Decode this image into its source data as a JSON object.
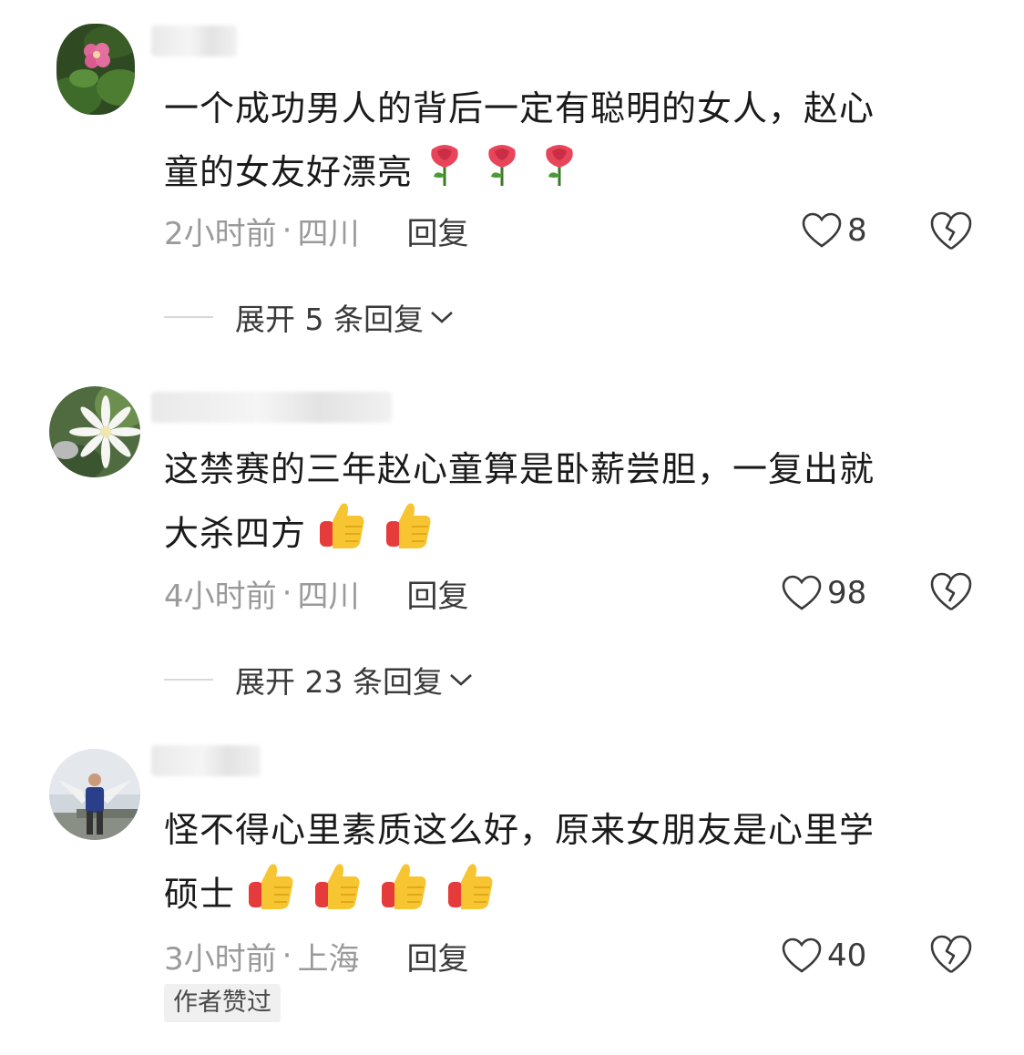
{
  "comments": [
    {
      "text_line1": "一个成功男人的背后一定有聪明的女人，赵心",
      "text_line2": "童的女友好漂亮",
      "emoji": "rose",
      "emoji_count": 3,
      "time": "2小时前",
      "location": "四川",
      "reply_label": "回复",
      "likes": "8",
      "expand_label": "展开 5 条回复"
    },
    {
      "text_line1": "这禁赛的三年赵心童算是卧薪尝胆，一复出就",
      "text_line2": "大杀四方",
      "emoji": "thumbs-up",
      "emoji_count": 2,
      "time": "4小时前",
      "location": "四川",
      "reply_label": "回复",
      "likes": "98",
      "expand_label": "展开 23 条回复"
    },
    {
      "text_line1": "怪不得心里素质这么好，原来女朋友是心里学",
      "text_line2": "硕士",
      "emoji": "thumbs-up",
      "emoji_count": 4,
      "time": "3小时前",
      "location": "上海",
      "reply_label": "回复",
      "likes": "40",
      "badge": "作者赞过"
    }
  ],
  "meta_separator": "·",
  "colors": {
    "text": "#1a1a1a",
    "meta": "#9a9a9a",
    "action": "#3a3a3a"
  }
}
